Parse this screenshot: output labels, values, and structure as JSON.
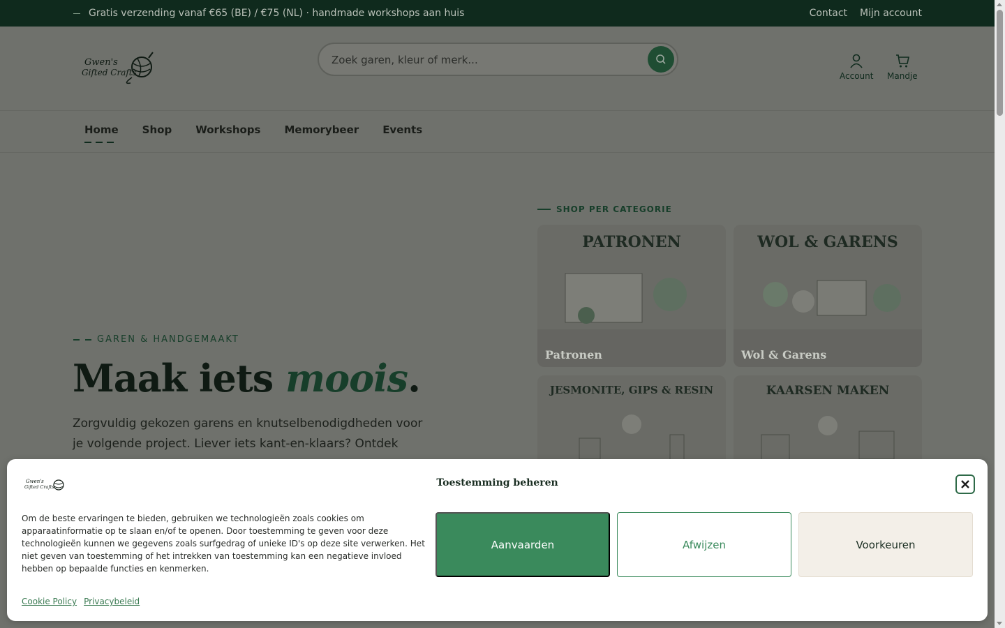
{
  "topbar": {
    "promo": "Gratis verzending vanaf €65 (BE) / €75 (NL) · handmade workshops aan huis",
    "links": [
      "Contact",
      "Mijn account"
    ]
  },
  "header": {
    "logo_text": "Gwen's Gifted Crafts",
    "search_placeholder": "Zoek garen, kleur of merk...",
    "icons": {
      "account_label": "Account",
      "cart_label": "Mandje"
    }
  },
  "nav": {
    "items": [
      "Home",
      "Shop",
      "Workshops",
      "Memorybeer",
      "Events"
    ],
    "active": "Home"
  },
  "hero": {
    "eyebrow": "GAREN & HANDGEMAAKT",
    "headline_main": "Maak iets",
    "headline_accent": "moois",
    "headline_end": ".",
    "lede": "Zorgvuldig gekozen garens en knutselbenodigdheden voor je volgende project. Liever iets kant-en-klaars? Ontdek onze"
  },
  "categories": {
    "label": "SHOP PER CATEGORIE",
    "tiles": [
      {
        "art_title": "PATRONEN",
        "name": "Patronen"
      },
      {
        "art_title": "WOL & GARENS",
        "name": "Wol & Garens"
      },
      {
        "art_title": "JESMONITE, GIPS & RESIN",
        "name": ""
      },
      {
        "art_title": "KAARSEN MAKEN",
        "name": ""
      }
    ]
  },
  "cookie_modal": {
    "title": "Toestemming beheren",
    "body": "Om de beste ervaringen te bieden, gebruiken we technologieën zoals cookies om apparaatinformatie op te slaan en/of te openen. Door toestemming te geven voor deze technologieën kunnen we gegevens zoals surfgedrag of unieke ID's op deze site verwerken. Het niet geven van toestemming of het intrekken van toestemming kan een negatieve invloed hebben op bepaalde functies en kenmerken.",
    "accept": "Aanvaarden",
    "deny": "Afwijzen",
    "prefs": "Voorkeuren",
    "links": [
      "Cookie Policy",
      "Privacybeleid"
    ]
  },
  "colors": {
    "topbar_bg": "#0f2a1d",
    "brand_green": "#3a8a5c",
    "overlay_bg": "#6f716c",
    "prefs_bg": "#f3efe8"
  }
}
